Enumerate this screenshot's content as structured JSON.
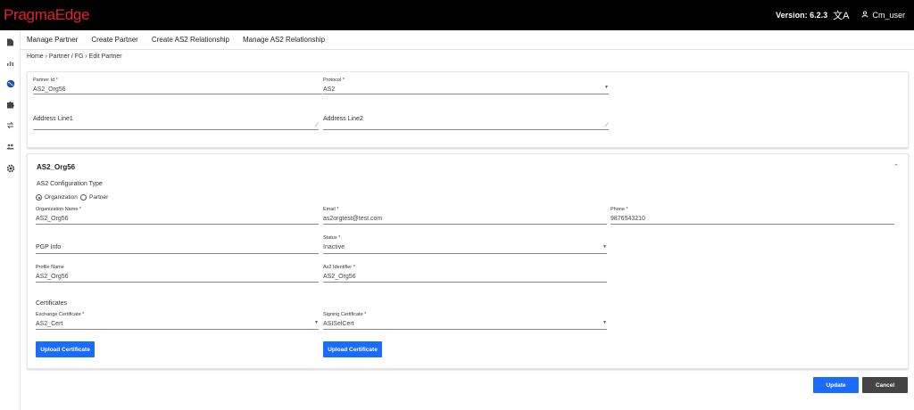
{
  "app": {
    "logo": "PragmaEdge",
    "version": "Version: 6.2.3",
    "translate_icon": "translate-icon",
    "user_icon": "user-icon",
    "user": "Cm_user"
  },
  "sidebar": {
    "icons": [
      "file-icon",
      "chart-icon",
      "globe-icon",
      "puzzle-icon",
      "transfer-icon",
      "users-icon",
      "gear-icon"
    ]
  },
  "nav": {
    "items": [
      "Manage Partner",
      "Create Partner",
      "Create AS2 Relationship",
      "Manage AS2 Relationship"
    ]
  },
  "breadcrumb": [
    "Home",
    "Partner / FG",
    "Edit Partner"
  ],
  "partner": {
    "partner_id": {
      "label": "Partner Id *",
      "value": "AS2_Org56"
    },
    "protocol": {
      "label": "Protocol *",
      "value": "AS2"
    },
    "address1": {
      "label": "Address Line1"
    },
    "address2": {
      "label": "Address Line2"
    }
  },
  "as2": {
    "title": "AS2_Org56",
    "config_title": "AS2 Configuration Type",
    "radio": {
      "organization": "Organization",
      "partner": "Partner",
      "selected": "Organization"
    },
    "org_name": {
      "label": "Organization Name *",
      "value": "AS2_Org56"
    },
    "email": {
      "label": "Email *",
      "value": "as2orgtest@test.com"
    },
    "phone": {
      "label": "Phone *",
      "value": "9876543210"
    },
    "pgp": {
      "label": "PGP Info"
    },
    "status": {
      "label": "Status *",
      "value": "Inactive"
    },
    "profile_name": {
      "label": "Profile Name",
      "value": "AS2_Org56"
    },
    "as2_identifier": {
      "label": "As2 Identifier *",
      "value": "AS2_Org56"
    },
    "certs_title": "Certificates",
    "exchange": {
      "label": "Exchange Certificate *",
      "value": "AS2_Cert"
    },
    "signing": {
      "label": "Signing Certificate *",
      "value": "ASISelCert"
    },
    "upload_label": "Upload Certificate"
  },
  "actions": {
    "update": "Update",
    "cancel": "Cancel"
  },
  "colors": {
    "topbar": "#000000",
    "logo": "#e3232b",
    "primary": "#1a6cff",
    "cancel": "#444444"
  }
}
